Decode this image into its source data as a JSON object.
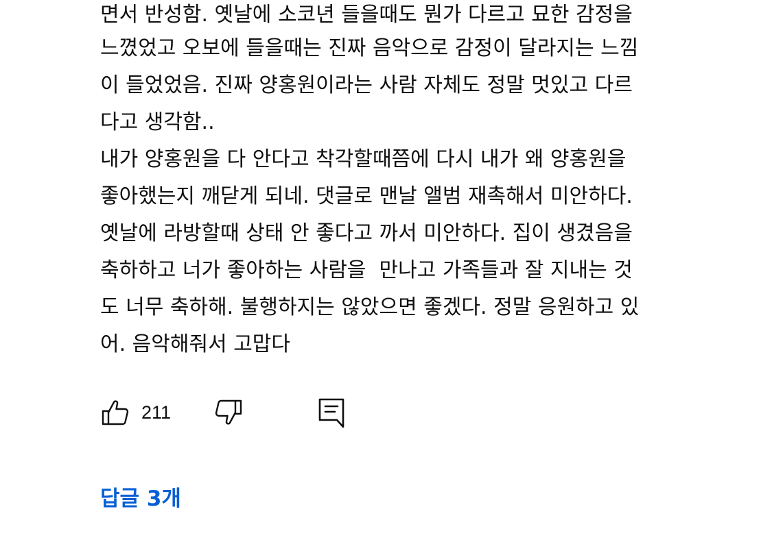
{
  "comment": {
    "lines": [
      "면서 반성함. 옛날에 소코년 들을때도 뭔가 다르고 묘한 감정을",
      "느꼈었고 오보에 들을때는 진짜 음악으로 감정이 달라지는 느낌",
      "이 들었었음. 진짜 양홍원이라는 사람 자체도 정말 멋있고 다르",
      "다고 생각함..",
      "내가 양홍원을 다 안다고 착각할때쯤에 다시 내가 왜 양홍원을",
      "좋아했는지 깨닫게 되네. 댓글로 맨날 앨범 재촉해서 미안하다.",
      "옛날에 라방할때 상태 안 좋다고 까서 미안하다. 집이 생겼음을",
      "축하하고 너가 좋아하는 사람을  만나고 가족들과 잘 지내는 것",
      "도 너무 축하해. 불행하지는 않았으면 좋겠다. 정말 응원하고 있",
      "어. 음악해줘서 고맙다"
    ]
  },
  "actions": {
    "like_count": "211",
    "like_icon": "thumbs-up-icon",
    "dislike_icon": "thumbs-down-icon",
    "reply_icon": "comment-icon"
  },
  "replies": {
    "label": "답글 3개"
  },
  "colors": {
    "text": "#0f0f0f",
    "link": "#065fd4",
    "background": "#ffffff"
  }
}
